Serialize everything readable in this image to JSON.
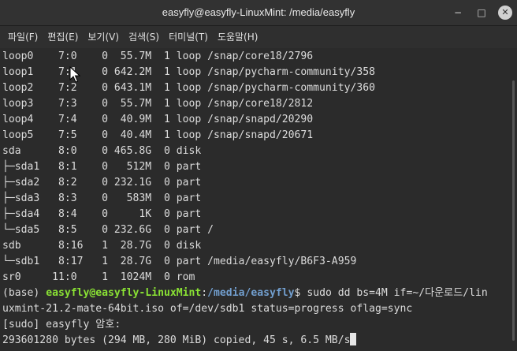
{
  "window": {
    "title": "easyfly@easyfly-LinuxMint: /media/easyfly",
    "minimize_glyph": "−",
    "maximize_glyph": "□",
    "close_glyph": "✕"
  },
  "menu": [
    "파일(F)",
    "편집(E)",
    "보기(V)",
    "검색(S)",
    "터미널(T)",
    "도움말(H)"
  ],
  "terminal": {
    "output_lines": [
      "loop0    7:0    0  55.7M  1 loop /snap/core18/2796",
      "loop1    7:1    0 642.2M  1 loop /snap/pycharm-community/358",
      "loop2    7:2    0 643.1M  1 loop /snap/pycharm-community/360",
      "loop3    7:3    0  55.7M  1 loop /snap/core18/2812",
      "loop4    7:4    0  40.9M  1 loop /snap/snapd/20290",
      "loop5    7:5    0  40.4M  1 loop /snap/snapd/20671",
      "sda      8:0    0 465.8G  0 disk",
      "├─sda1   8:1    0   512M  0 part",
      "├─sda2   8:2    0 232.1G  0 part",
      "├─sda3   8:3    0   583M  0 part",
      "├─sda4   8:4    0     1K  0 part",
      "└─sda5   8:5    0 232.6G  0 part /",
      "sdb      8:16   1  28.7G  0 disk",
      "└─sdb1   8:17   1  28.7G  0 part /media/easyfly/B6F3-A959",
      "sr0     11:0    1  1024M  0 rom"
    ],
    "prompt": {
      "env": "(base) ",
      "user_host": "easyfly@easyfly-LinuxMint",
      "colon": ":",
      "path": "/media/easyfly",
      "dollar": "$ ",
      "command_part1": "sudo dd bs=4M if=~/다운로드/lin",
      "command_part2": "uxmint-21.2-mate-64bit.iso of=/dev/sdb1 status=progress oflag=sync"
    },
    "sudo_prompt": "[sudo] easyfly 암호:",
    "progress_line": "293601280 bytes (294 MB, 280 MiB) copied, 45 s, 6.5 MB/s"
  },
  "colors": {
    "user_host": "#8ae234",
    "path": "#729fcf",
    "text": "#dcdcdc",
    "background": "#2b2b2b"
  },
  "icons": {
    "cursor": "mouse-pointer-icon"
  }
}
